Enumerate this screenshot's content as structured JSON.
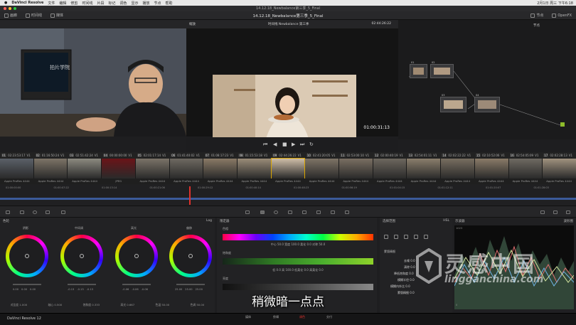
{
  "menubar": {
    "app": "DaVinci Resolve",
    "items": [
      "文件",
      "编辑",
      "修剪",
      "时间线",
      "片段",
      "标记",
      "调色",
      "显示",
      "播放",
      "节点",
      "帮助"
    ],
    "status": "2月1日 周三 下午6:18"
  },
  "window": {
    "title": "14.12.18_Newbalance第三季_5_Final"
  },
  "toolbar": {
    "media_pool": "画廊",
    "luts": "时间线",
    "lut_browser": "媒体",
    "project_title": "14.12.18_Newbalance第三季_5_Final",
    "keyframes": "节点",
    "openfx": "OpenFX"
  },
  "viewer": {
    "timeline_name": "时间线 Newbalance 第三季",
    "zoom_label": "缩放",
    "timecode_top": "02:44:26:22",
    "timecode": "01:00:31:13",
    "nodes_label": "节点"
  },
  "inset": {
    "logo_text": "拍片学院"
  },
  "nodes": [
    {
      "id": "01"
    },
    {
      "id": "02"
    },
    {
      "id": "03"
    },
    {
      "id": "04"
    }
  ],
  "clip_strip": {
    "clips": [
      {
        "num": "01",
        "tc": "02:23:53:17",
        "track": "V1",
        "label": "Apple ProRes 4444"
      },
      {
        "num": "02",
        "tc": "01:16:50:24",
        "track": "V1",
        "label": "Apple ProRes 4444"
      },
      {
        "num": "03",
        "tc": "02:51:42:24",
        "track": "V1",
        "label": "Apple ProRes 4444"
      },
      {
        "num": "04",
        "tc": "00:00:00:00",
        "track": "V1",
        "label": "JPEG"
      },
      {
        "num": "05",
        "tc": "02:01:17:14",
        "track": "V1",
        "label": "Apple ProRes 4444"
      },
      {
        "num": "06",
        "tc": "01:41:40:02",
        "track": "V1",
        "label": "Apple ProRes 4444"
      },
      {
        "num": "07",
        "tc": "01:08:17:23",
        "track": "V1",
        "label": "Apple ProRes 4444"
      },
      {
        "num": "08",
        "tc": "01:15:53:18",
        "track": "V1",
        "label": "Apple ProRes 4444"
      },
      {
        "num": "09",
        "tc": "02:44:26:22",
        "track": "V1",
        "label": "Apple ProRes 4444"
      },
      {
        "num": "10",
        "tc": "02:41:20:05",
        "track": "V1",
        "label": "Apple ProRes 4444"
      },
      {
        "num": "11",
        "tc": "02:53:00:10",
        "track": "V1",
        "label": "Apple ProRes 4444"
      },
      {
        "num": "12",
        "tc": "02:00:40:19",
        "track": "V1",
        "label": "Apple ProRes 4444"
      },
      {
        "num": "13",
        "tc": "02:54:01:11",
        "track": "V1",
        "label": "Apple ProRes 4444"
      },
      {
        "num": "14",
        "tc": "02:02:22:22",
        "track": "V1",
        "label": "Apple ProRes 4444"
      },
      {
        "num": "15",
        "tc": "02:10:52:06",
        "track": "V1",
        "label": "Apple ProRes 4444"
      },
      {
        "num": "16",
        "tc": "02:54:05:09",
        "track": "V1",
        "label": "Apple ProRes 4444"
      },
      {
        "num": "17",
        "tc": "02:02:28:13",
        "track": "V1",
        "label": "Apple ProRes 4444"
      }
    ]
  },
  "ruler": [
    "01:00:00:00",
    "01:00:07:22",
    "01:00:13:14",
    "01:00:21:06",
    "01:00:29:12",
    "01:00:40:14",
    "01:00:48:23",
    "01:00:56:19",
    "01:01:04:15",
    "01:01:12:11",
    "01:01:20:07",
    "01:01:28:03"
  ],
  "wheels_panel": {
    "title": "色轮",
    "mode": "Log",
    "wheels": [
      {
        "label": "阴影",
        "vals": [
          "0.00",
          "0.00",
          "0.00"
        ]
      },
      {
        "label": "中间调",
        "vals": [
          "-0.13",
          "-0.13",
          "-0.13"
        ]
      },
      {
        "label": "高光",
        "vals": [
          "-0.06",
          "-0.06",
          "-0.06"
        ]
      },
      {
        "label": "偏移",
        "vals": [
          "25.00",
          "25.00",
          "25.00"
        ]
      }
    ],
    "bottom": [
      "对比度 1.000",
      "轴心 0.500",
      "饱和度 0.333",
      "高光 0.667",
      "色温 50.00",
      "色调 50.00"
    ]
  },
  "curves_panel": {
    "title": "限定器",
    "hue_label": "色相",
    "hue_row": "中心 50.0   宽度 100.0   柔化 0.0   对称 50.0",
    "sat_label": "饱和度",
    "sat_row": "低 0.0   高 100.0   低柔化 0.0   高柔化 0.0",
    "lum_label": "亮度",
    "lum_row": "低 0.0   高 100.0   低柔化 0.0   高柔化 0.0"
  },
  "qualifier_panel": {
    "title": "选择范围",
    "mode": "HSL",
    "matte_title": "蒙版精细",
    "rows": [
      "去噪 0.0",
      "清除 0.0",
      "降低饱和度 0.0",
      "模糊半径 0.0",
      "模糊内外比 0.0",
      "蒙版精细 0.0"
    ]
  },
  "scope_panel": {
    "title": "示波器",
    "mode": "波形图",
    "max": "1023",
    "min": "0"
  },
  "bottom_bar": {
    "app_name": "DaVinci Resolve 12",
    "pages": [
      "媒体",
      "剪辑",
      "调色",
      "交付"
    ]
  },
  "subtitle": "稍微暗一点点",
  "watermark": {
    "big": "灵感中国",
    "url": "lingganchina.com"
  },
  "colors": {
    "accent_red": "#e0312c",
    "track_blue": "#3b5a9a",
    "bg": "#1e1e20"
  }
}
